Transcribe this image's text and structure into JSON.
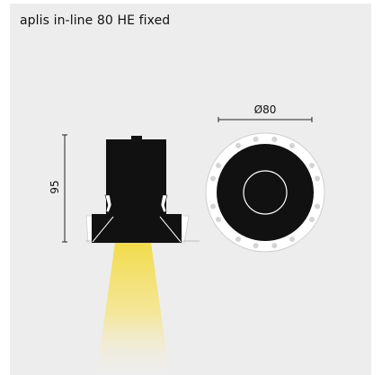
{
  "title": "aplis in-line 80 HE fixed",
  "dimensions": {
    "height_label": "95",
    "diameter_label": "Ø80"
  },
  "colors": {
    "background": "#ededed",
    "body": "#111111",
    "trim": "#ffffff",
    "light_beam": "#f2dc4a",
    "line": "#222222"
  }
}
